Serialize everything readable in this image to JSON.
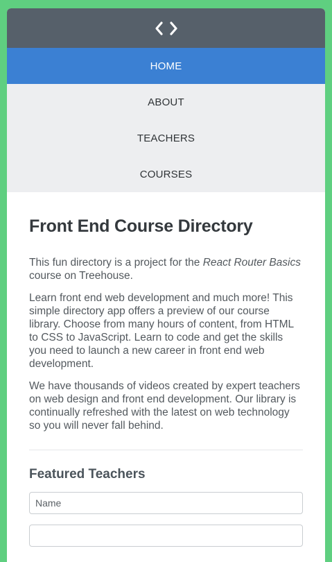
{
  "header": {
    "logo_icon": "code-brackets-icon"
  },
  "nav": {
    "items": [
      {
        "label": "HOME",
        "active": true
      },
      {
        "label": "ABOUT",
        "active": false
      },
      {
        "label": "TEACHERS",
        "active": false
      },
      {
        "label": "COURSES",
        "active": false
      }
    ]
  },
  "main": {
    "title": "Front End Course Directory",
    "intro": {
      "before": "This fun directory is a project for the ",
      "emphasis": "React Router Basics",
      "after": " course on Treehouse."
    },
    "paragraph2": "Learn front end web development and much more! This simple directory app offers a preview of our course library. Choose from many hours of content, from HTML to CSS to JavaScript. Learn to code and get the skills you need to launch a new career in front end web development.",
    "paragraph3": "We have thousands of videos created by expert teachers on web design and front end development. Our library is continually refreshed with the latest on web technology so you will never fall behind.",
    "featured_heading": "Featured Teachers",
    "form": {
      "name_placeholder": "Name",
      "name_value": "",
      "second_placeholder": "",
      "second_value": ""
    }
  },
  "colors": {
    "page_bg": "#5fcf80",
    "header_bg": "#56606a",
    "nav_active": "#3b80d3",
    "nav_bg": "#edeef0"
  }
}
